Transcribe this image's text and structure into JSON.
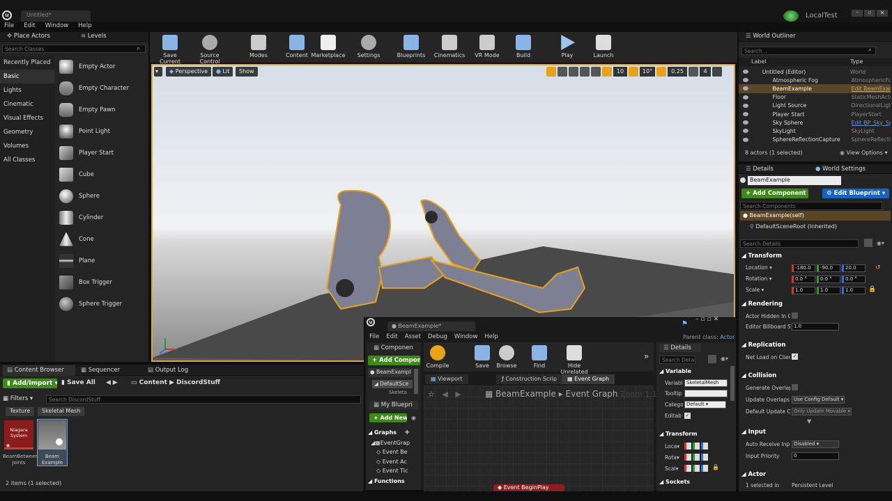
{
  "window": {
    "tab_title": "Untitled*",
    "project_name": "LocalTest"
  },
  "menubar": [
    "File",
    "Edit",
    "Window",
    "Help"
  ],
  "place_actors": {
    "tab_label": "Place Actors",
    "levels_tab": "Levels",
    "search_placeholder": "Search Classes",
    "categories": [
      "Recently Placed",
      "Basic",
      "Lights",
      "Cinematic",
      "Visual Effects",
      "Geometry",
      "Volumes",
      "All Classes"
    ],
    "actors": [
      "Empty Actor",
      "Empty Character",
      "Empty Pawn",
      "Point Light",
      "Player Start",
      "Cube",
      "Sphere",
      "Cylinder",
      "Cone",
      "Plane",
      "Box Trigger",
      "Sphere Trigger"
    ]
  },
  "toolbar": [
    "Save Current",
    "Source Control",
    "Modes",
    "Content",
    "Marketplace",
    "Settings",
    "Blueprints",
    "Cinematics",
    "VR Mode",
    "Build",
    "Play",
    "Launch"
  ],
  "viewport": {
    "perspective": "Perspective",
    "lit": "Lit",
    "show": "Show",
    "grid_snap": "10",
    "rot_snap": "10°",
    "scale_snap": "0.25",
    "cam_speed": "4"
  },
  "world_outliner": {
    "title": "World Outliner",
    "search_placeholder": "Search...",
    "col_label": "Label",
    "col_type": "Type",
    "rows": [
      {
        "label": "Untitled (Editor)",
        "type": "World"
      },
      {
        "label": "Atmospheric Fog",
        "type": "AtmosphericFog"
      },
      {
        "label": "BeamExample",
        "type": "Edit BeamExam"
      },
      {
        "label": "Floor",
        "type": "StaticMeshActo"
      },
      {
        "label": "Light Source",
        "type": "DirectionalLight"
      },
      {
        "label": "Player Start",
        "type": "PlayerStart"
      },
      {
        "label": "Sky Sphere",
        "type": "Edit BP_Sky_Sp"
      },
      {
        "label": "SkyLight",
        "type": "SkyLight"
      },
      {
        "label": "SphereReflectionCapture",
        "type": "SphereReflection"
      }
    ],
    "footer": "8 actors (1 selected)",
    "view_options": "View Options"
  },
  "details": {
    "tab_details": "Details",
    "tab_world_settings": "World Settings",
    "actor_name": "BeamExample",
    "add_component": "+ Add Component",
    "edit_blueprint": "Edit Blueprint",
    "search_components": "Search Components",
    "component_self": "BeamExample(self)",
    "component_root": "DefaultSceneRoot (Inherited)",
    "search_details": "Search Details",
    "transform_title": "Transform",
    "location_label": "Location",
    "rotation_label": "Rotation",
    "scale_label": "Scale",
    "location": [
      "-180.0",
      "-90.0",
      "20.0"
    ],
    "rotation": [
      "0.0 °",
      "0.0 °",
      "0.0 °"
    ],
    "scale": [
      "1.0",
      "1.0",
      "1.0"
    ],
    "rendering_title": "Rendering",
    "actor_hidden": "Actor Hidden In Ga",
    "billboard": "Editor Billboard Sc",
    "billboard_val": "1.0",
    "replication_title": "Replication",
    "net_load": "Net Load on Client",
    "collision_title": "Collision",
    "gen_overlap": "Generate Overlap E",
    "update_overlaps": "Update Overlaps M",
    "update_overlaps_val": "Use Config Default",
    "default_update": "Default Update Ove",
    "default_update_val": "Only Update Movable",
    "input_title": "Input",
    "auto_receive": "Auto Receive Input",
    "auto_receive_val": "Disabled",
    "input_priority": "Input Priority",
    "input_priority_val": "0",
    "actor_title": "Actor",
    "selected_in": "1 selected in",
    "persistent_level": "Persistent Level"
  },
  "content_browser": {
    "tab": "Content Browser",
    "sequencer_tab": "Sequencer",
    "output_log_tab": "Output Log",
    "add_import": "Add/Import",
    "save_all": "Save All",
    "path": [
      "Content",
      "DiscordStuff"
    ],
    "filters": "Filters",
    "search_placeholder": "Search DiscordStuff",
    "filter_chips": [
      "Texture",
      "Skeletal Mesh"
    ],
    "assets": [
      {
        "thumb_label": "Niagara System",
        "name": "BeamBetween Joints"
      },
      {
        "thumb_label": "",
        "name": "Beam Example"
      }
    ],
    "footer": "2 items (1 selected)"
  },
  "blueprint_editor": {
    "tab": "BeamExample*",
    "parent_class_label": "Parent class:",
    "parent_class_value": "Actor",
    "menu": [
      "File",
      "Edit",
      "Asset",
      "Debug",
      "Window",
      "Help"
    ],
    "components_tab": "Componen",
    "add_component": "+ Add Compone",
    "component_items": [
      "BeamExampl",
      "DefaultSce",
      "Skeleta"
    ],
    "toolbar": [
      "Compile",
      "Save",
      "Browse",
      "Find",
      "Hide Unrelated"
    ],
    "tabs": [
      "Viewport",
      "Construction Scrip",
      "Event Graph"
    ],
    "breadcrumb_root": "BeamExample",
    "breadcrumb_graph": "Event Graph",
    "zoom": "Zoom 1:1",
    "my_blueprint": "My Bluepri",
    "add_new": "+ Add New",
    "graphs_label": "Graphs",
    "graph_items": [
      "EventGrap",
      "Event Be",
      "Event Ac",
      "Event Tic"
    ],
    "functions_label": "Functions",
    "event_node": "Event BeginPlay",
    "details_tab": "Details",
    "details_search": "Search Detail",
    "variable_section": "Variable",
    "var_name_label": "Variabl",
    "var_name": "SkeletalMesh",
    "tooltip_label": "Tooltip",
    "category_label": "Catego",
    "category_val": "Default",
    "editable_label": "Editab",
    "transform_section": "Transform",
    "loc_label": "Loca",
    "rot_label": "Rota",
    "scale_label": "Scal",
    "sockets_section": "Sockets"
  }
}
